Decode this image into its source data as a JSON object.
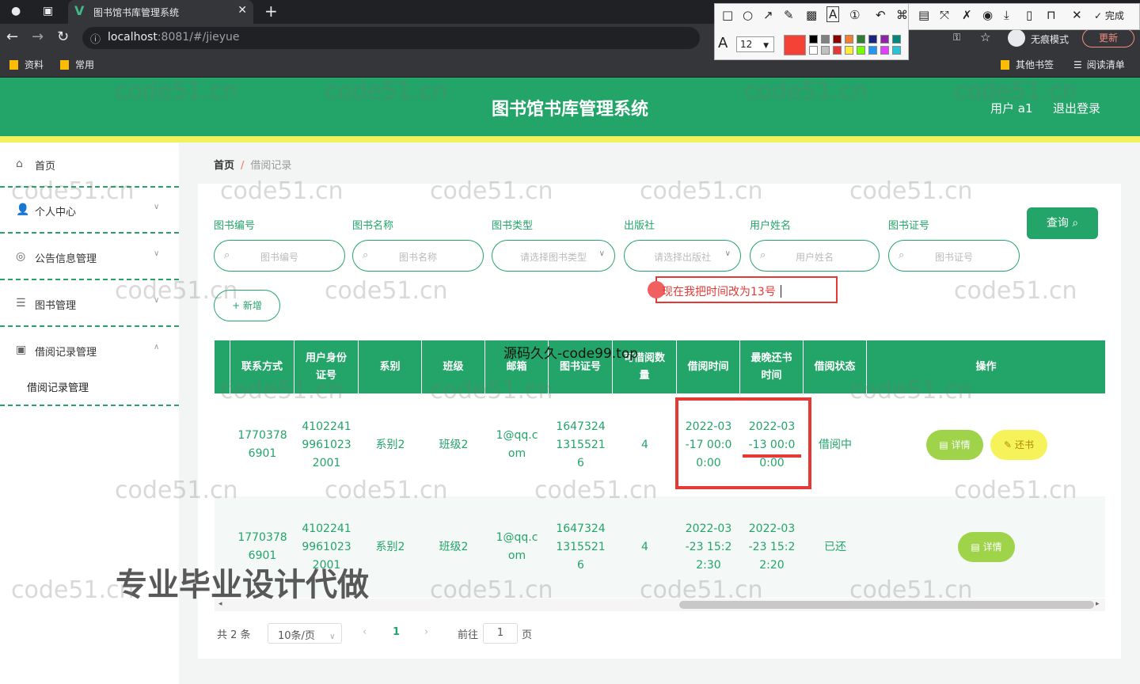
{
  "browser": {
    "tab_title": "图书馆书库管理系统",
    "url_host": "localhost",
    "url_rest": ":8081/#/jieyue",
    "bookmarks": [
      "资料",
      "常用"
    ],
    "right_bookmarks": [
      "其他书签",
      "阅读清单"
    ],
    "incognito_label": "无痕模式",
    "update_label": "更新",
    "done_label": "完成",
    "font_size": "12"
  },
  "header": {
    "title": "图书馆书库管理系统",
    "user": "用户 a1",
    "logout": "退出登录"
  },
  "sidebar": {
    "items": [
      {
        "label": "首页",
        "icon": "home-icon"
      },
      {
        "label": "个人中心",
        "icon": "user-icon"
      },
      {
        "label": "公告信息管理",
        "icon": "notice-icon"
      },
      {
        "label": "图书管理",
        "icon": "list-icon"
      },
      {
        "label": "借阅记录管理",
        "icon": "record-icon"
      }
    ],
    "sub_item": "借阅记录管理"
  },
  "breadcrumb": {
    "home": "首页",
    "sep": "/",
    "current": "借阅记录"
  },
  "filters": [
    {
      "label": "图书编号",
      "placeholder": "图书编号",
      "type": "input"
    },
    {
      "label": "图书名称",
      "placeholder": "图书名称",
      "type": "input"
    },
    {
      "label": "图书类型",
      "placeholder": "请选择图书类型",
      "type": "select"
    },
    {
      "label": "出版社",
      "placeholder": "请选择出版社",
      "type": "select"
    },
    {
      "label": "用户姓名",
      "placeholder": "用户姓名",
      "type": "input"
    },
    {
      "label": "图书证号",
      "placeholder": "图书证号",
      "type": "input"
    }
  ],
  "query_label": "查询",
  "add_label": "+ 新增",
  "annotation": "现在我把时间改为13号",
  "table": {
    "headers": [
      "联系方式",
      "用户身份证号",
      "系别",
      "班级",
      "邮箱",
      "图书证号",
      "可借阅数量",
      "借阅时间",
      "最晚还书时间",
      "借阅状态",
      "操作"
    ],
    "header_lines": [
      [
        "联系方式"
      ],
      [
        "用户身份",
        "证号"
      ],
      [
        "系别"
      ],
      [
        "班级"
      ],
      [
        "邮箱"
      ],
      [
        "图书证号"
      ],
      [
        "可借阅数",
        "量"
      ],
      [
        "借阅时间"
      ],
      [
        "最晚还书",
        "时间"
      ],
      [
        "借阅状态"
      ],
      [
        "操作"
      ]
    ],
    "rows": [
      {
        "cells": [
          [
            "1770378",
            "6901"
          ],
          [
            "4102241",
            "9961023",
            "2001"
          ],
          [
            "系别2"
          ],
          [
            "班级2"
          ],
          [
            "1@qq.c",
            "om"
          ],
          [
            "1647324",
            "1315521",
            "6"
          ],
          [
            "4"
          ],
          [
            "2022-03",
            "-17 00:0",
            "0:00"
          ],
          [
            "2022-03",
            "-13 00:0",
            "0:00"
          ],
          [
            "借阅中"
          ]
        ],
        "actions": {
          "detail": "详情",
          "return": "还书"
        }
      },
      {
        "cells": [
          [
            "1770378",
            "6901"
          ],
          [
            "4102241",
            "9961023",
            "2001"
          ],
          [
            "系别2"
          ],
          [
            "班级2"
          ],
          [
            "1@qq.c",
            "om"
          ],
          [
            "1647324",
            "1315521",
            "6"
          ],
          [
            "4"
          ],
          [
            "2022-03",
            "-23 15:2",
            "2:30"
          ],
          [
            "2022-03",
            "-23 15:2",
            "2:20"
          ],
          [
            "已还"
          ]
        ],
        "actions": {
          "detail": "详情"
        }
      }
    ]
  },
  "pagination": {
    "total": "共 2 条",
    "page_size": "10条/页",
    "current": "1",
    "goto": "前往",
    "goto_value": "1",
    "page_unit": "页"
  },
  "overlays": {
    "source": "源码久久-code99.top",
    "promo": "专业毕业设计代做",
    "watermark": "code51.cn"
  },
  "colors": {
    "brand": "#23a468",
    "header_stripe": "#f3f25e",
    "annotation": "#e53935",
    "detail_btn": "#9ed34a",
    "return_btn": "#f6f35a"
  }
}
